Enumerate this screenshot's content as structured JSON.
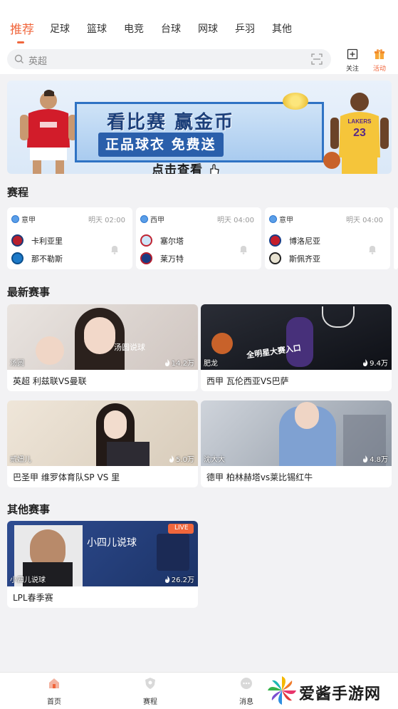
{
  "tabs": [
    "推荐",
    "足球",
    "篮球",
    "电竞",
    "台球",
    "网球",
    "乒羽",
    "其他"
  ],
  "search": {
    "placeholder": "英超"
  },
  "top_actions": {
    "follow_label": "关注",
    "activity_label": "活动"
  },
  "banner": {
    "headline": "看比赛 赢金币",
    "subline": "正品球衣  免费送",
    "cta": "点击查看"
  },
  "sections": {
    "schedule": "赛程",
    "latest": "最新赛事",
    "other": "其他赛事"
  },
  "schedule": [
    {
      "league": "意甲",
      "time": "明天 02:00",
      "home": "卡利亚里",
      "away": "那不勒斯"
    },
    {
      "league": "西甲",
      "time": "明天 04:00",
      "home": "塞尔塔",
      "away": "莱万特"
    },
    {
      "league": "意甲",
      "time": "明天 04:00",
      "home": "博洛尼亚",
      "away": "斯佩齐亚"
    }
  ],
  "latest": [
    {
      "anchor": "汤圆",
      "heat": "14.2万",
      "title": "英超 利兹联VS曼联",
      "overlay": "汤圆说球"
    },
    {
      "anchor": "肥龙",
      "heat": "9.4万",
      "title": "西甲 瓦伦西亚VS巴萨",
      "overlay": "全明星大赛入口"
    },
    {
      "anchor": "贰妞儿",
      "heat": "5.0万",
      "title": "巴圣甲 维罗体育队SP VS 里"
    },
    {
      "anchor": "沈大大",
      "heat": "4.8万",
      "title": "德甲 柏林赫塔vs莱比锡红牛"
    }
  ],
  "other": [
    {
      "anchor": "小四儿说球",
      "heat": "26.2万",
      "title": "LPL春季赛",
      "overlay": "小四儿说球",
      "badge": "LIVE"
    }
  ],
  "bottom_nav": [
    {
      "label": "首页"
    },
    {
      "label": "赛程"
    },
    {
      "label": "消息"
    }
  ],
  "watermark": "爱酱手游网",
  "colors": {
    "accent": "#f0663c",
    "background": "#f2f2f4",
    "banner_blue": "#2a5fab"
  }
}
